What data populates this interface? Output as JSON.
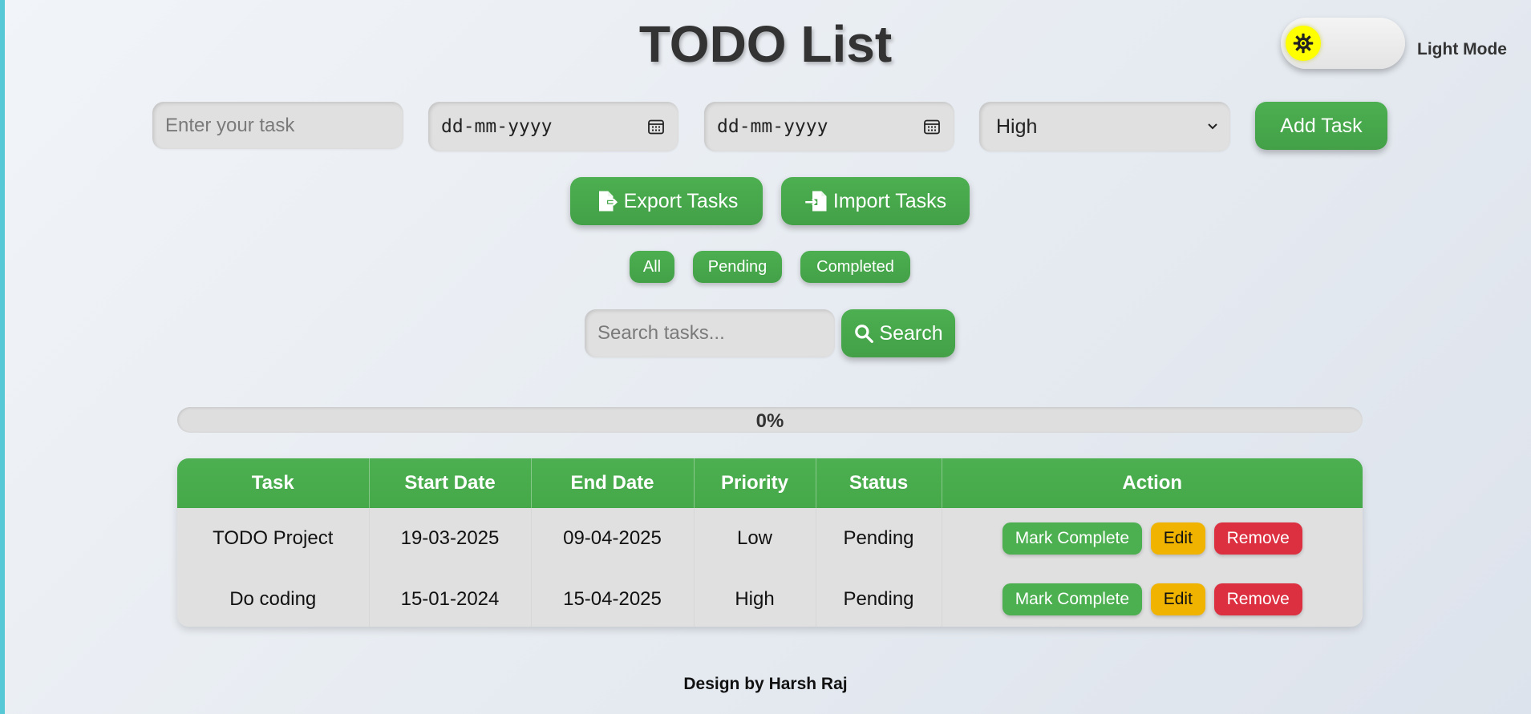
{
  "header": {
    "title": "TODO List",
    "theme_toggle_label": "Light Mode"
  },
  "form": {
    "task_placeholder": "Enter your task",
    "start_date_value": "dd-mm-yyyy",
    "end_date_value": "dd-mm-yyyy",
    "priority_selected": "High",
    "add_button": "Add Task"
  },
  "io": {
    "export_button": "Export Tasks",
    "import_button": "Import Tasks"
  },
  "filters": {
    "all": "All",
    "pending": "Pending",
    "completed": "Completed"
  },
  "search": {
    "placeholder": "Search tasks...",
    "button": "Search"
  },
  "progress": {
    "percent_label": "0%",
    "value": 0
  },
  "table": {
    "columns": [
      "Task",
      "Start Date",
      "End Date",
      "Priority",
      "Status",
      "Action"
    ],
    "rows": [
      {
        "task": "TODO Project",
        "start": "19-03-2025",
        "end": "09-04-2025",
        "priority": "Low",
        "status": "Pending"
      },
      {
        "task": "Do coding",
        "start": "15-01-2024",
        "end": "15-04-2025",
        "priority": "High",
        "status": "Pending"
      }
    ],
    "actions": {
      "complete": "Mark Complete",
      "edit": "Edit",
      "remove": "Remove"
    }
  },
  "footer": {
    "text": "Design by Harsh Raj"
  },
  "colors": {
    "primary_green": "#4caf50",
    "edit_yellow": "#f0b400",
    "remove_red": "#dc2f3f",
    "toggle_knob": "#ffff00"
  },
  "icons": {
    "theme": "sun-gear-icon",
    "calendar": "calendar-icon",
    "select": "chevron-down-icon",
    "export": "file-export-icon",
    "import": "file-import-icon",
    "search": "search-icon"
  }
}
